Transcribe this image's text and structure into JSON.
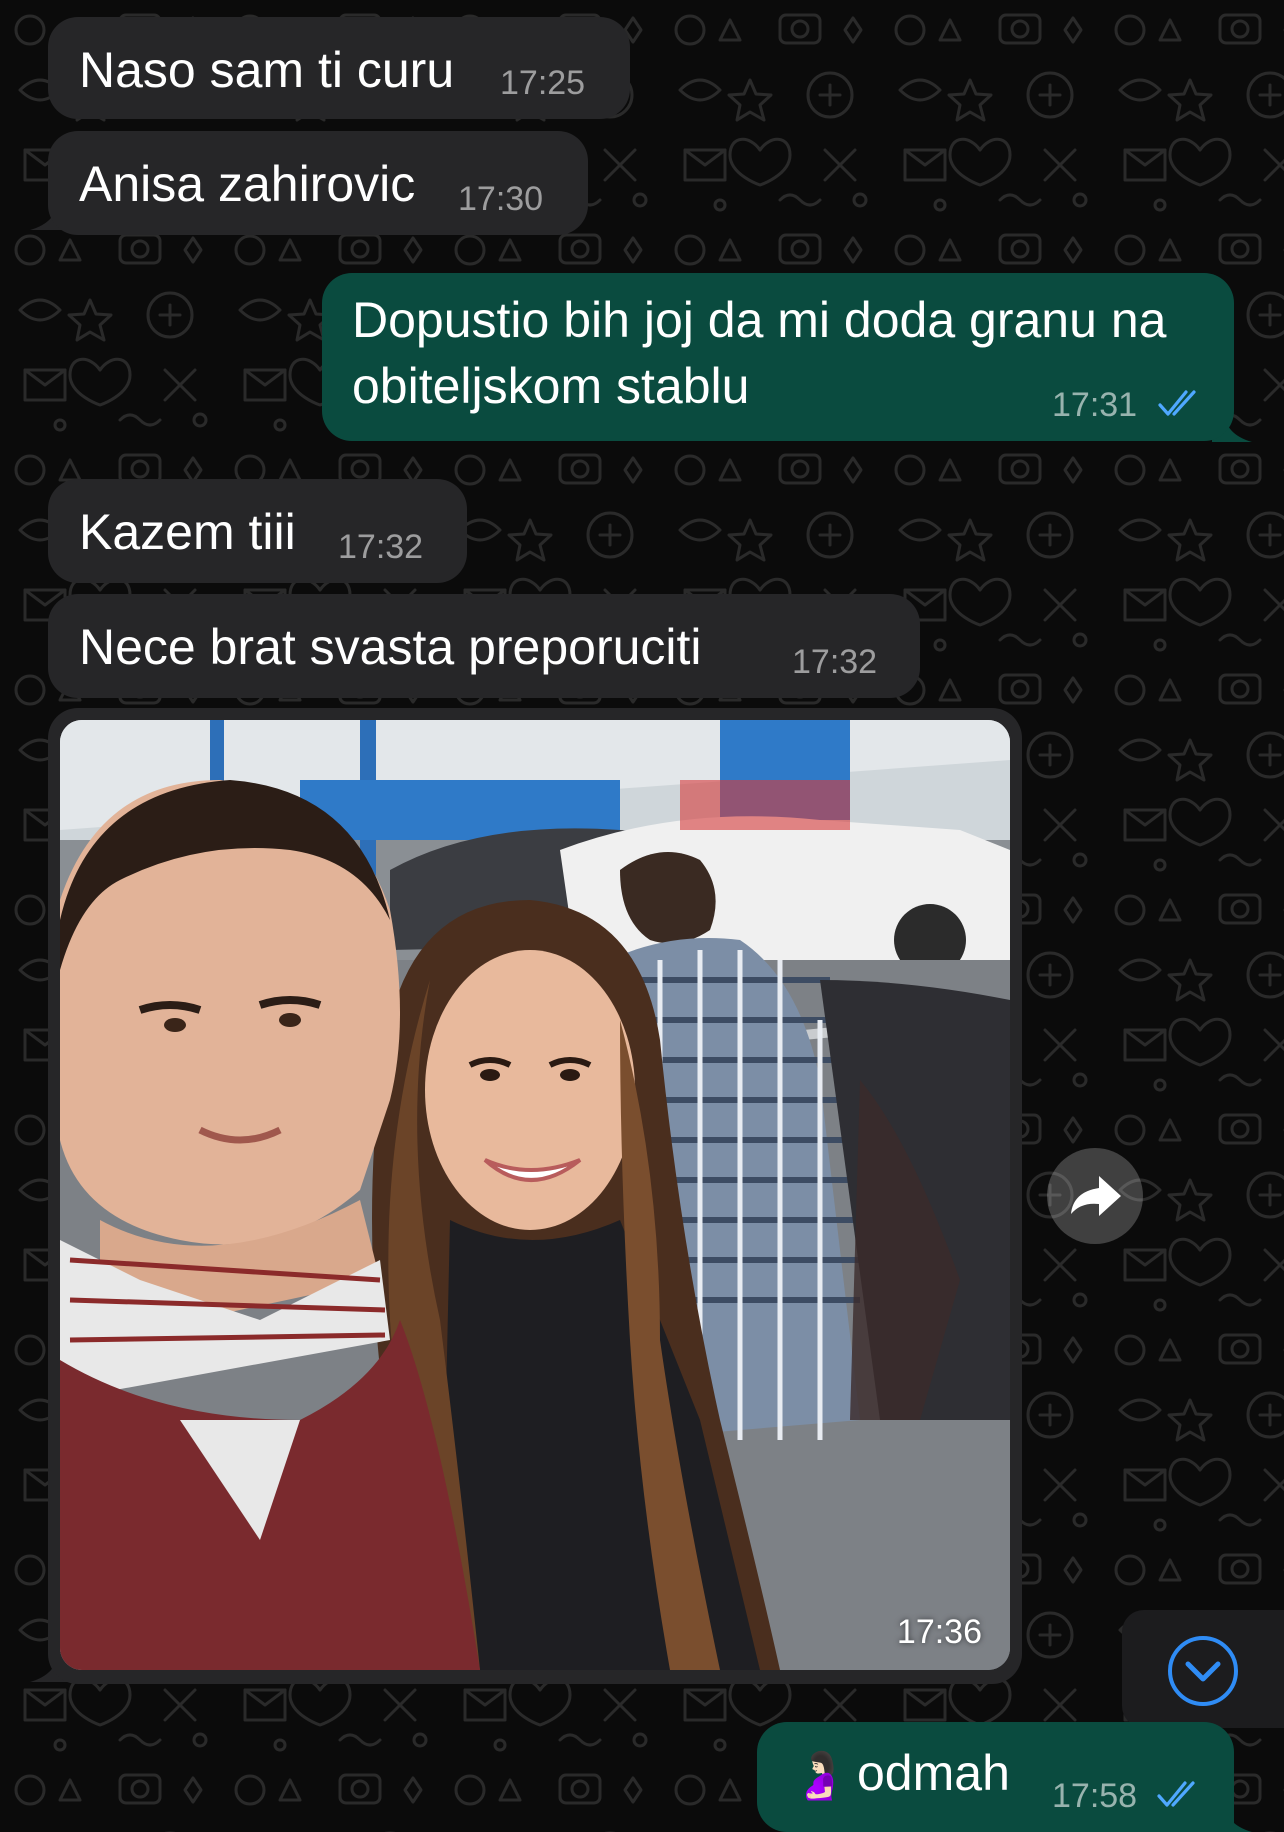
{
  "theme": {
    "background": "#0b0b0b",
    "incoming_bubble": "#262628",
    "outgoing_bubble": "#0a4b3f",
    "read_ticks": "#4fa8ff"
  },
  "messages": [
    {
      "direction": "incoming",
      "text": "Naso sam ti curu",
      "time": "17:25"
    },
    {
      "direction": "incoming",
      "text": "Anisa zahirovic",
      "time": "17:30"
    },
    {
      "direction": "outgoing",
      "lines": [
        "Dopustio bih joj da mi doda granu na",
        "obiteljskom stablu"
      ],
      "time": "17:31",
      "status": "read"
    },
    {
      "direction": "incoming",
      "text": "Kazem tiii",
      "time": "17:32"
    },
    {
      "direction": "incoming",
      "text": "Nece brat svasta preporuciti",
      "time": "17:32"
    },
    {
      "direction": "incoming",
      "type": "photo",
      "time": "17:36",
      "photo_icon": "selfie-photo"
    },
    {
      "direction": "outgoing",
      "emoji": "🤰🏻",
      "text": "odmah",
      "time": "17:58",
      "status": "read"
    }
  ],
  "controls": {
    "forward_icon": "forward-arrow-icon",
    "scroll_down_icon": "chevron-down-circle-icon"
  }
}
